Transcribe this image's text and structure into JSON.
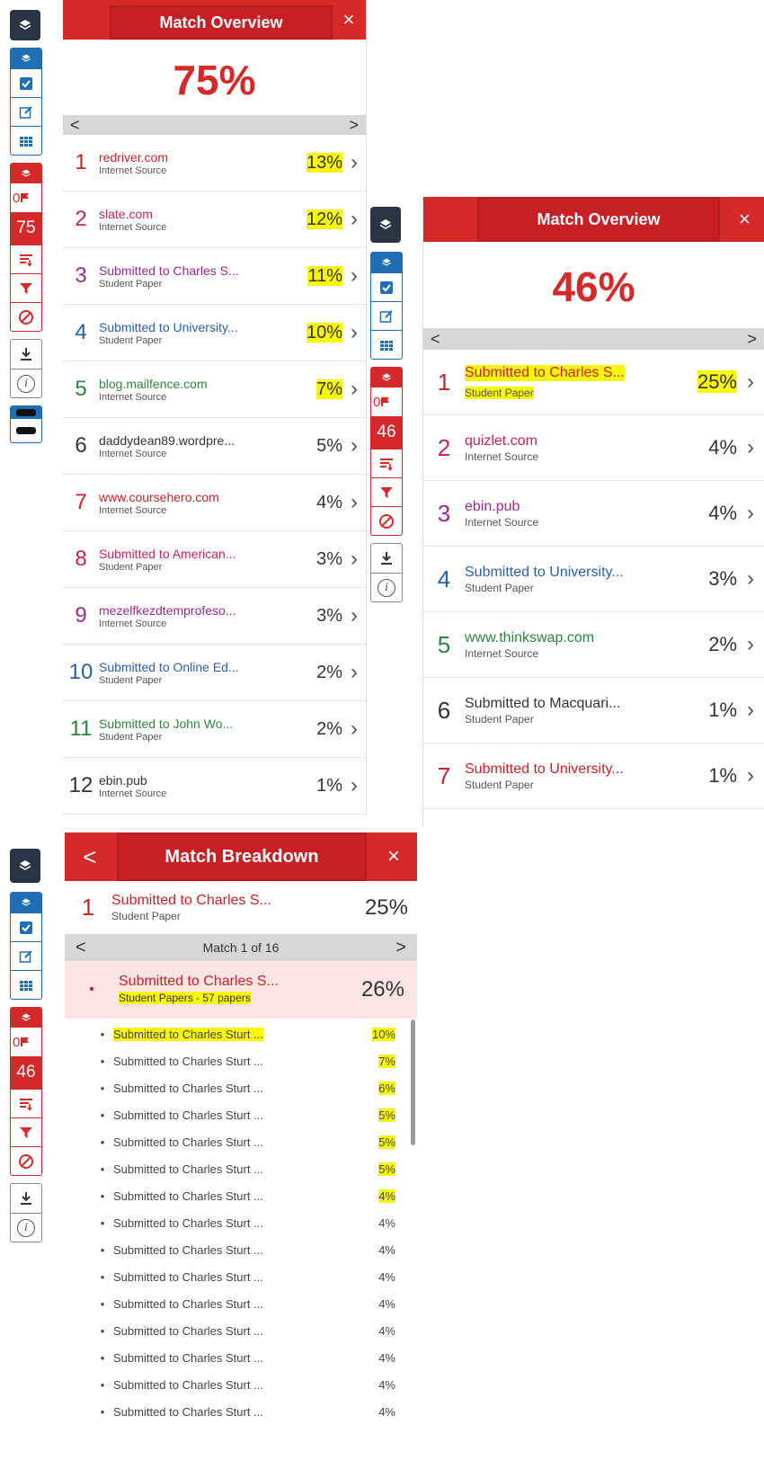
{
  "panel1": {
    "title": "Match Overview",
    "close": "×",
    "percent": "75%",
    "score": "75",
    "flags": "0",
    "nav": {
      "prev": "<",
      "next": ">"
    },
    "rows": [
      {
        "n": "1",
        "name": "redriver.com",
        "type": "Internet Source",
        "pct": "13%",
        "color": "#c8232b",
        "hl": true
      },
      {
        "n": "2",
        "name": "slate.com",
        "type": "Internet Source",
        "pct": "12%",
        "color": "#c8235a",
        "hl": true
      },
      {
        "n": "3",
        "name": "Submitted to Charles S...",
        "type": "Student Paper",
        "pct": "11%",
        "color": "#9b2a8a",
        "hl": true
      },
      {
        "n": "4",
        "name": "Submitted to University...",
        "type": "Student Paper",
        "pct": "10%",
        "color": "#2a5fa8",
        "hl": true
      },
      {
        "n": "5",
        "name": "blog.mailfence.com",
        "type": "Internet Source",
        "pct": "7%",
        "color": "#2e8540",
        "hl": true
      },
      {
        "n": "6",
        "name": "daddydean89.wordpre...",
        "type": "Internet Source",
        "pct": "5%",
        "color": "#333333",
        "hl": false
      },
      {
        "n": "7",
        "name": "www.coursehero.com",
        "type": "Internet Source",
        "pct": "4%",
        "color": "#c8232b",
        "hl": false
      },
      {
        "n": "8",
        "name": "Submitted to American...",
        "type": "Student Paper",
        "pct": "3%",
        "color": "#c8235a",
        "hl": false
      },
      {
        "n": "9",
        "name": "mezelfkezdtemprofeso...",
        "type": "Internet Source",
        "pct": "3%",
        "color": "#9b2a8a",
        "hl": false
      },
      {
        "n": "10",
        "name": "Submitted to Online Ed...",
        "type": "Student Paper",
        "pct": "2%",
        "color": "#2a5fa8",
        "hl": false
      },
      {
        "n": "11",
        "name": "Submitted to John Wo...",
        "type": "Student Paper",
        "pct": "2%",
        "color": "#2e8540",
        "hl": false
      },
      {
        "n": "12",
        "name": "ebin.pub",
        "type": "Internet Source",
        "pct": "1%",
        "color": "#333333",
        "hl": false
      }
    ]
  },
  "panel2": {
    "title": "Match Overview",
    "close": "×",
    "percent": "46%",
    "score": "46",
    "flags": "0",
    "nav": {
      "prev": "<",
      "next": ">"
    },
    "rows": [
      {
        "n": "1",
        "name": "Submitted to Charles S...",
        "type": "Student Paper",
        "pct": "25%",
        "color": "#c8232b",
        "hl": true
      },
      {
        "n": "2",
        "name": "quizlet.com",
        "type": "Internet Source",
        "pct": "4%",
        "color": "#c8235a",
        "hl": false
      },
      {
        "n": "3",
        "name": "ebin.pub",
        "type": "Internet Source",
        "pct": "4%",
        "color": "#9b2a8a",
        "hl": false
      },
      {
        "n": "4",
        "name": "Submitted to University...",
        "type": "Student Paper",
        "pct": "3%",
        "color": "#2a5fa8",
        "hl": false
      },
      {
        "n": "5",
        "name": "www.thinkswap.com",
        "type": "Internet Source",
        "pct": "2%",
        "color": "#2e8540",
        "hl": false
      },
      {
        "n": "6",
        "name": "Submitted to Macquari...",
        "type": "Student Paper",
        "pct": "1%",
        "color": "#333333",
        "hl": false
      },
      {
        "n": "7",
        "name": "Submitted to University...",
        "type": "Student Paper",
        "pct": "1%",
        "color": "#c8232b",
        "hl": false
      }
    ]
  },
  "panel3": {
    "title": "Match Breakdown",
    "back": "<",
    "close": "×",
    "score": "46",
    "flags": "0",
    "source": {
      "n": "1",
      "name": "Submitted to Charles S...",
      "type": "Student Paper",
      "pct": "25%"
    },
    "pager": {
      "prev": "<",
      "label": "Match 1 of 16",
      "next": ">"
    },
    "group": {
      "bullet": "•",
      "name": "Submitted to Charles S...",
      "sub": "Student Papers - 57 papers",
      "pct": "26%"
    },
    "items": [
      {
        "name": "Submitted to Charles Sturt ...",
        "pct": "10%",
        "hl_name": true,
        "hl_pct": true
      },
      {
        "name": "Submitted to Charles Sturt ...",
        "pct": "7%",
        "hl_name": false,
        "hl_pct": true
      },
      {
        "name": "Submitted to Charles Sturt ...",
        "pct": "6%",
        "hl_name": false,
        "hl_pct": true
      },
      {
        "name": "Submitted to Charles Sturt ...",
        "pct": "5%",
        "hl_name": false,
        "hl_pct": true
      },
      {
        "name": "Submitted to Charles Sturt ...",
        "pct": "5%",
        "hl_name": false,
        "hl_pct": true
      },
      {
        "name": "Submitted to Charles Sturt ...",
        "pct": "5%",
        "hl_name": false,
        "hl_pct": true
      },
      {
        "name": "Submitted to Charles Sturt ...",
        "pct": "4%",
        "hl_name": false,
        "hl_pct": true
      },
      {
        "name": "Submitted to Charles Sturt ...",
        "pct": "4%",
        "hl_name": false,
        "hl_pct": false
      },
      {
        "name": "Submitted to Charles Sturt ...",
        "pct": "4%",
        "hl_name": false,
        "hl_pct": false
      },
      {
        "name": "Submitted to Charles Sturt ...",
        "pct": "4%",
        "hl_name": false,
        "hl_pct": false
      },
      {
        "name": "Submitted to Charles Sturt ...",
        "pct": "4%",
        "hl_name": false,
        "hl_pct": false
      },
      {
        "name": "Submitted to Charles Sturt ...",
        "pct": "4%",
        "hl_name": false,
        "hl_pct": false
      },
      {
        "name": "Submitted to Charles Sturt ...",
        "pct": "4%",
        "hl_name": false,
        "hl_pct": false
      },
      {
        "name": "Submitted to Charles Sturt ...",
        "pct": "4%",
        "hl_name": false,
        "hl_pct": false
      },
      {
        "name": "Submitted to Charles Sturt ...",
        "pct": "4%",
        "hl_name": false,
        "hl_pct": false
      }
    ]
  },
  "icons": {
    "layers": "layers-icon",
    "check": "checkbox-icon",
    "edit": "edit-icon",
    "grid": "grid-icon",
    "flag": "flag-icon",
    "sort": "sort-icon",
    "filter": "filter-icon",
    "exclude": "exclude-icon",
    "download": "download-icon",
    "info": "info-icon"
  }
}
